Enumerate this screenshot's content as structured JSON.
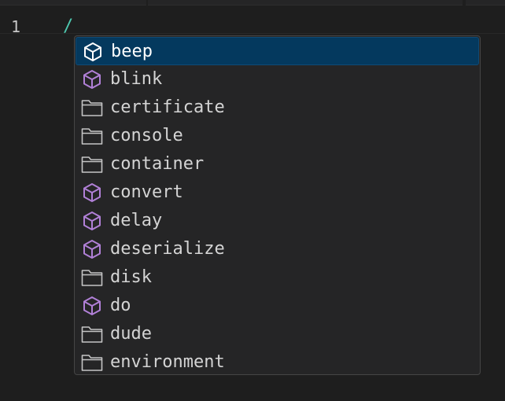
{
  "editor": {
    "line_number": "1",
    "code": "/"
  },
  "suggestions": [
    {
      "label": "beep",
      "kind": "module",
      "icon": "cube-icon",
      "selected": true
    },
    {
      "label": "blink",
      "kind": "module",
      "icon": "cube-icon",
      "selected": false
    },
    {
      "label": "certificate",
      "kind": "folder",
      "icon": "folder-icon",
      "selected": false
    },
    {
      "label": "console",
      "kind": "folder",
      "icon": "folder-icon",
      "selected": false
    },
    {
      "label": "container",
      "kind": "folder",
      "icon": "folder-icon",
      "selected": false
    },
    {
      "label": "convert",
      "kind": "module",
      "icon": "cube-icon",
      "selected": false
    },
    {
      "label": "delay",
      "kind": "module",
      "icon": "cube-icon",
      "selected": false
    },
    {
      "label": "deserialize",
      "kind": "module",
      "icon": "cube-icon",
      "selected": false
    },
    {
      "label": "disk",
      "kind": "folder",
      "icon": "folder-icon",
      "selected": false
    },
    {
      "label": "do",
      "kind": "module",
      "icon": "cube-icon",
      "selected": false
    },
    {
      "label": "dude",
      "kind": "folder",
      "icon": "folder-icon",
      "selected": false
    },
    {
      "label": "environment",
      "kind": "folder",
      "icon": "folder-icon",
      "selected": false
    }
  ],
  "colors": {
    "module_icon": "#b180d7",
    "module_icon_selected": "#ffffff",
    "folder_icon": "#c5c5c5",
    "selection_bg": "#04395e"
  }
}
